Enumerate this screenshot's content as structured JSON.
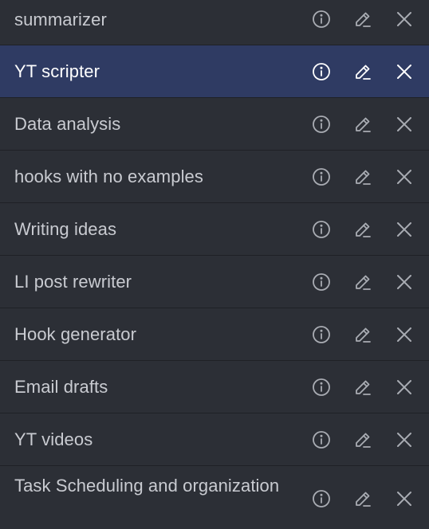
{
  "items": [
    {
      "label": "summarizer",
      "selected": false
    },
    {
      "label": "YT scripter",
      "selected": true
    },
    {
      "label": "Data analysis",
      "selected": false
    },
    {
      "label": "hooks with no examples",
      "selected": false
    },
    {
      "label": "Writing ideas",
      "selected": false
    },
    {
      "label": "LI post rewriter",
      "selected": false
    },
    {
      "label": "Hook generator",
      "selected": false
    },
    {
      "label": "Email drafts",
      "selected": false
    },
    {
      "label": "YT videos",
      "selected": false
    },
    {
      "label": "Task Scheduling and organization",
      "selected": false
    }
  ],
  "icons": {
    "info": "info-icon",
    "edit": "pencil-icon",
    "close": "close-icon"
  },
  "colors": {
    "background": "#2c2f36",
    "selected_background": "#2f3b63",
    "text": "#c9cbd1",
    "selected_text": "#ffffff",
    "icon": "#a9acb3"
  }
}
